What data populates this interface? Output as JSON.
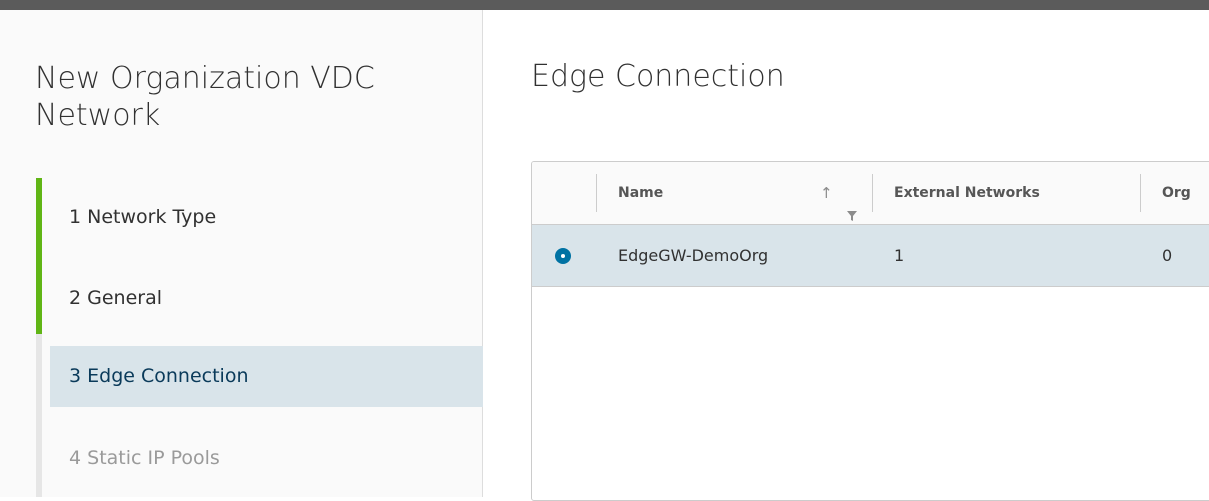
{
  "wizard": {
    "title": "New Organization VDC Network",
    "steps": [
      {
        "label": "1 Network Type",
        "state": "done"
      },
      {
        "label": "2 General",
        "state": "done"
      },
      {
        "label": "3 Edge Connection",
        "state": "current"
      },
      {
        "label": "4 Static IP Pools",
        "state": "disabled"
      }
    ]
  },
  "main": {
    "title": "Edge Connection"
  },
  "grid": {
    "columns": [
      {
        "label": "Name",
        "sort": "ascending",
        "filter_icon": "filter-icon",
        "sort_icon": "arrow-up-icon"
      },
      {
        "label": "External Networks"
      },
      {
        "label": "Org"
      }
    ],
    "rows": [
      {
        "selected": true,
        "name": "EdgeGW-DemoOrg",
        "external_networks": "1",
        "org": "0"
      }
    ]
  },
  "colors": {
    "step_done": "#60b515",
    "selection": "#d9e4ea",
    "radio": "#0072a3"
  }
}
